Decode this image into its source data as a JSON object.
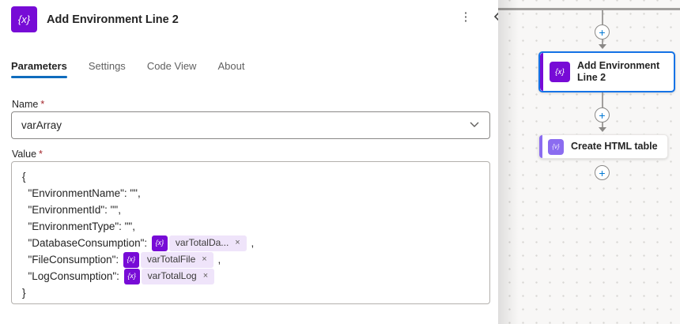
{
  "colors": {
    "variables_purple": "#770BD6",
    "data_operation_purple": "#8B6CF0",
    "selection_blue": "#1573E6",
    "tab_underline_blue": "#0F6CBD",
    "plus_blue": "#0078D4",
    "token_background": "#EFE4FA",
    "required_red": "#A4262C"
  },
  "panel": {
    "title": "Add Environment Line 2",
    "title_icon_glyph": "{x}",
    "more_options_glyph": "⋮",
    "tabs": [
      {
        "label": "Parameters",
        "active": true
      },
      {
        "label": "Settings",
        "active": false
      },
      {
        "label": "Code View",
        "active": false
      },
      {
        "label": "About",
        "active": false
      }
    ],
    "name_field": {
      "label": "Name",
      "required_mark": "*",
      "value": "varArray"
    },
    "value_field": {
      "label": "Value",
      "required_mark": "*",
      "token_icon_glyph": "{x}",
      "token_close_glyph": "×",
      "lines": [
        {
          "text": "{"
        },
        {
          "text": "  \"EnvironmentName\": \"\","
        },
        {
          "text": "  \"EnvironmentId\": \"\","
        },
        {
          "text": "  \"EnvironmentType\": \"\","
        },
        {
          "prefix": "  \"DatabaseConsumption\": ",
          "token": "varTotalDa...",
          "suffix": " ,"
        },
        {
          "prefix": "  \"FileConsumption\": ",
          "token": "varTotalFile",
          "suffix": " ,"
        },
        {
          "prefix": "  \"LogConsumption\": ",
          "token": "varTotalLog",
          "suffix": ""
        },
        {
          "text": "}"
        }
      ]
    }
  },
  "canvas": {
    "plus_glyph": "+",
    "node_add_environment": {
      "label": "Add Environment Line 2",
      "icon_glyph": "{x}",
      "selected": true
    },
    "node_create_html_table": {
      "label": "Create HTML table",
      "icon_glyph": "{v}",
      "selected": false
    }
  }
}
